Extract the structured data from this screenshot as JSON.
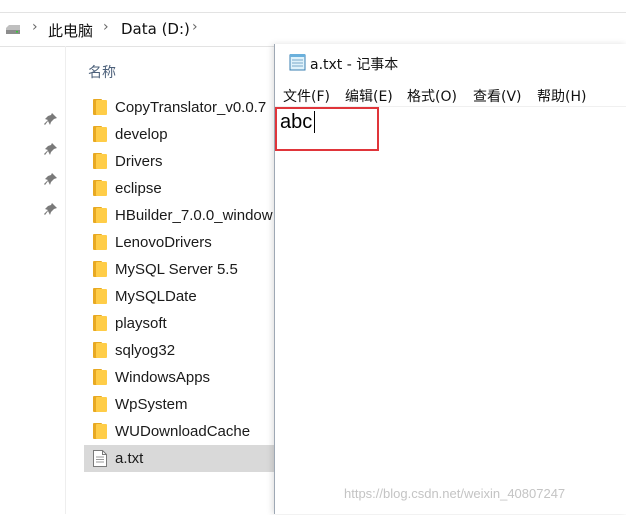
{
  "explorer": {
    "breadcrumb": [
      "此电脑",
      "Data (D:)"
    ],
    "column_header": "名称",
    "files": [
      {
        "name": "CopyTranslator_v0.0.7",
        "type": "folder"
      },
      {
        "name": "develop",
        "type": "folder"
      },
      {
        "name": "Drivers",
        "type": "folder"
      },
      {
        "name": "eclipse",
        "type": "folder"
      },
      {
        "name": "HBuilder_7.0.0_window",
        "type": "folder"
      },
      {
        "name": "LenovoDrivers",
        "type": "folder"
      },
      {
        "name": "MySQL Server 5.5",
        "type": "folder"
      },
      {
        "name": "MySQLDate",
        "type": "folder"
      },
      {
        "name": "playsoft",
        "type": "folder"
      },
      {
        "name": "sqlyog32",
        "type": "folder"
      },
      {
        "name": "WindowsApps",
        "type": "folder"
      },
      {
        "name": "WpSystem",
        "type": "folder"
      },
      {
        "name": "WUDownloadCache",
        "type": "folder"
      },
      {
        "name": "a.txt",
        "type": "text-file",
        "selected": true
      }
    ]
  },
  "notepad": {
    "title": "a.txt - 记事本",
    "menu": [
      "文件(F)",
      "编辑(E)",
      "格式(O)",
      "查看(V)",
      "帮助(H)"
    ],
    "content": "abc",
    "highlight_color": "#e0353a"
  },
  "watermark": "https://blog.csdn.net/weixin_40807247",
  "colors": {
    "folder": "#ffcd48",
    "selection": "#d9d9d9"
  }
}
